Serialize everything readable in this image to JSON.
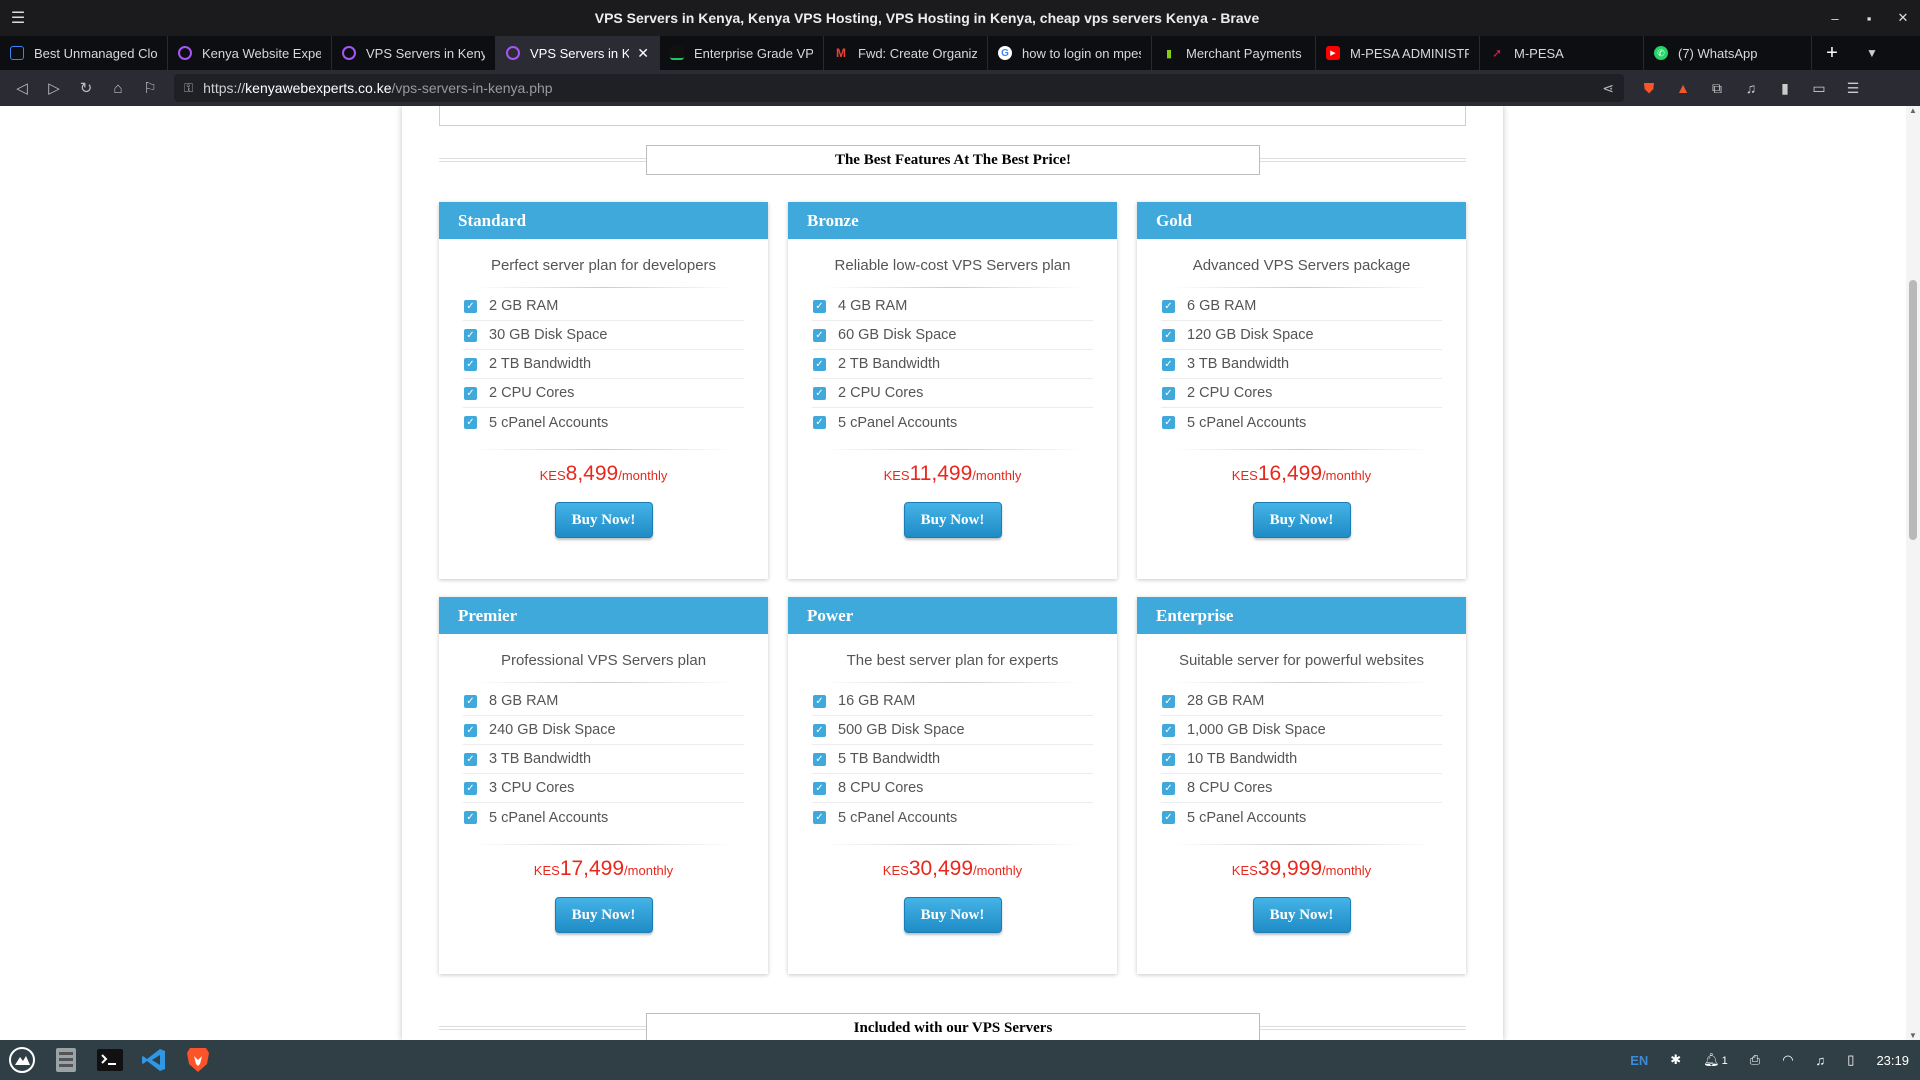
{
  "window": {
    "title": "VPS Servers in Kenya, Kenya VPS Hosting, VPS Hosting in Kenya, cheap vps servers Kenya - Brave"
  },
  "tabs": [
    {
      "label": "Best Unmanaged Clou",
      "color": "#3b82f6"
    },
    {
      "label": "Kenya Website Experts",
      "color": "#a855f7"
    },
    {
      "label": "VPS Servers in Kenya, K",
      "color": "#a855f7"
    },
    {
      "label": "VPS Servers in Ken",
      "color": "#a855f7",
      "active": true
    },
    {
      "label": "Enterprise Grade VPS",
      "color": "#22c55e"
    },
    {
      "label": "Fwd: Create Organizati",
      "color": "#ea4335"
    },
    {
      "label": "how to login on mpesa",
      "color": "#4285f4"
    },
    {
      "label": "Merchant Payments P",
      "color": "#84cc16"
    },
    {
      "label": "M-PESA ADMINISTRAT",
      "color": "#ff0000"
    },
    {
      "label": "M-PESA",
      "color": "#e11d48"
    },
    {
      "label": "(7) WhatsApp",
      "color": "#25d366"
    }
  ],
  "address": {
    "scheme": "https://",
    "host": "kenyawebexperts.co.ke",
    "path": "/vps-servers-in-kenya.php"
  },
  "sections": {
    "features_heading": "The Best Features At The Best Price!",
    "included_heading": "Included with our VPS Servers"
  },
  "plans": [
    {
      "name": "Standard",
      "desc": "Perfect server plan for developers",
      "features": [
        "2 GB RAM",
        "30 GB Disk Space",
        "2 TB Bandwidth",
        "2 CPU Cores",
        "5 cPanel Accounts"
      ],
      "currency": "KES",
      "price": "8,499",
      "period": "/monthly",
      "button": "Buy Now!"
    },
    {
      "name": "Bronze",
      "desc": "Reliable low-cost VPS Servers plan",
      "features": [
        "4 GB RAM",
        "60 GB Disk Space",
        "2 TB Bandwidth",
        "2 CPU Cores",
        "5 cPanel Accounts"
      ],
      "currency": "KES",
      "price": "11,499",
      "period": "/monthly",
      "button": "Buy Now!"
    },
    {
      "name": "Gold",
      "desc": "Advanced VPS Servers package",
      "features": [
        "6 GB RAM",
        "120 GB Disk Space",
        "3 TB Bandwidth",
        "2 CPU Cores",
        "5 cPanel Accounts"
      ],
      "currency": "KES",
      "price": "16,499",
      "period": "/monthly",
      "button": "Buy Now!"
    },
    {
      "name": "Premier",
      "desc": "Professional VPS Servers plan",
      "features": [
        "8 GB RAM",
        "240 GB Disk Space",
        "3 TB Bandwidth",
        "3 CPU Cores",
        "5 cPanel Accounts"
      ],
      "currency": "KES",
      "price": "17,499",
      "period": "/monthly",
      "button": "Buy Now!"
    },
    {
      "name": "Power",
      "desc": "The best server plan for experts",
      "features": [
        "16 GB RAM",
        "500 GB Disk Space",
        "5 TB Bandwidth",
        "8 CPU Cores",
        "5 cPanel Accounts"
      ],
      "currency": "KES",
      "price": "30,499",
      "period": "/monthly",
      "button": "Buy Now!"
    },
    {
      "name": "Enterprise",
      "desc": "Suitable server for powerful websites",
      "features": [
        "28 GB RAM",
        "1,000 GB Disk Space",
        "10 TB Bandwidth",
        "8 CPU Cores",
        "5 cPanel Accounts"
      ],
      "currency": "KES",
      "price": "39,999",
      "period": "/monthly",
      "button": "Buy Now!"
    }
  ],
  "taskbar": {
    "lang": "EN",
    "notif_count": "1",
    "clock": "23:19"
  },
  "colors": {
    "accent": "#3fa9dc",
    "price": "#e8281d"
  }
}
